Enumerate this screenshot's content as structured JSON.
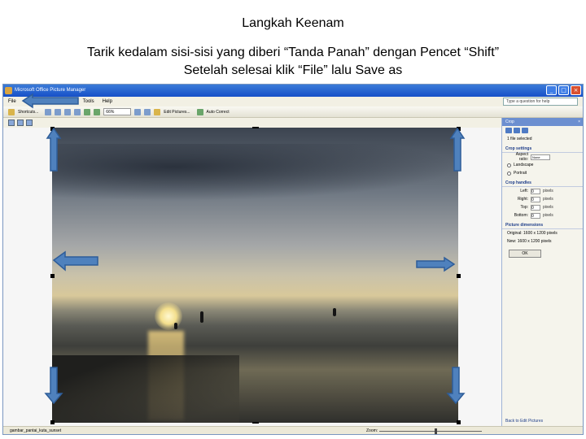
{
  "slide": {
    "title": "Langkah Keenam",
    "instruction_line1": "Tarik kedalam sisi-sisi yang diberi “Tanda Panah” dengan Pencet “Shift”",
    "instruction_line2": "Setelah selesai klik “File” lalu Save as"
  },
  "app": {
    "window_title": "Microsoft Office Picture Manager",
    "menu": [
      "File",
      "Edit",
      "View",
      "Picture",
      "Tools",
      "Help"
    ],
    "help_placeholder": "Type a question for help",
    "toolbar": {
      "shortcuts_label": "Shortcuts...",
      "zoom_value": "66%",
      "edit_pictures_label": "Edit Pictures...",
      "auto_correct_label": "Auto Correct"
    },
    "task_pane": {
      "title": "Crop",
      "selected_text": "1 file selected",
      "crop_settings_heading": "Crop settings",
      "aspect_ratio_label": "Aspect ratio:",
      "aspect_ratio_value": "None",
      "landscape_label": "Landscape",
      "portrait_label": "Portrait",
      "crop_handles_heading": "Crop handles",
      "handles": [
        {
          "label": "Left:",
          "value": "0",
          "unit": "pixels"
        },
        {
          "label": "Right:",
          "value": "0",
          "unit": "pixels"
        },
        {
          "label": "Top:",
          "value": "0",
          "unit": "pixels"
        },
        {
          "label": "Bottom:",
          "value": "0",
          "unit": "pixels"
        }
      ],
      "dimensions_heading": "Picture dimensions",
      "original_label": "Original: 1600 x 1200 pixels",
      "new_label": "New: 1600 x 1200 pixels",
      "ok_label": "OK",
      "footer_link": "Back to Edit Pictures"
    },
    "status": {
      "filename": "gambar_pantai_kuta_sunset",
      "zoom_label": "Zoom:"
    }
  },
  "colors": {
    "arrow_fill": "#4f81bd",
    "arrow_stroke": "#2e5d99",
    "titlebar": "#1650c8"
  }
}
